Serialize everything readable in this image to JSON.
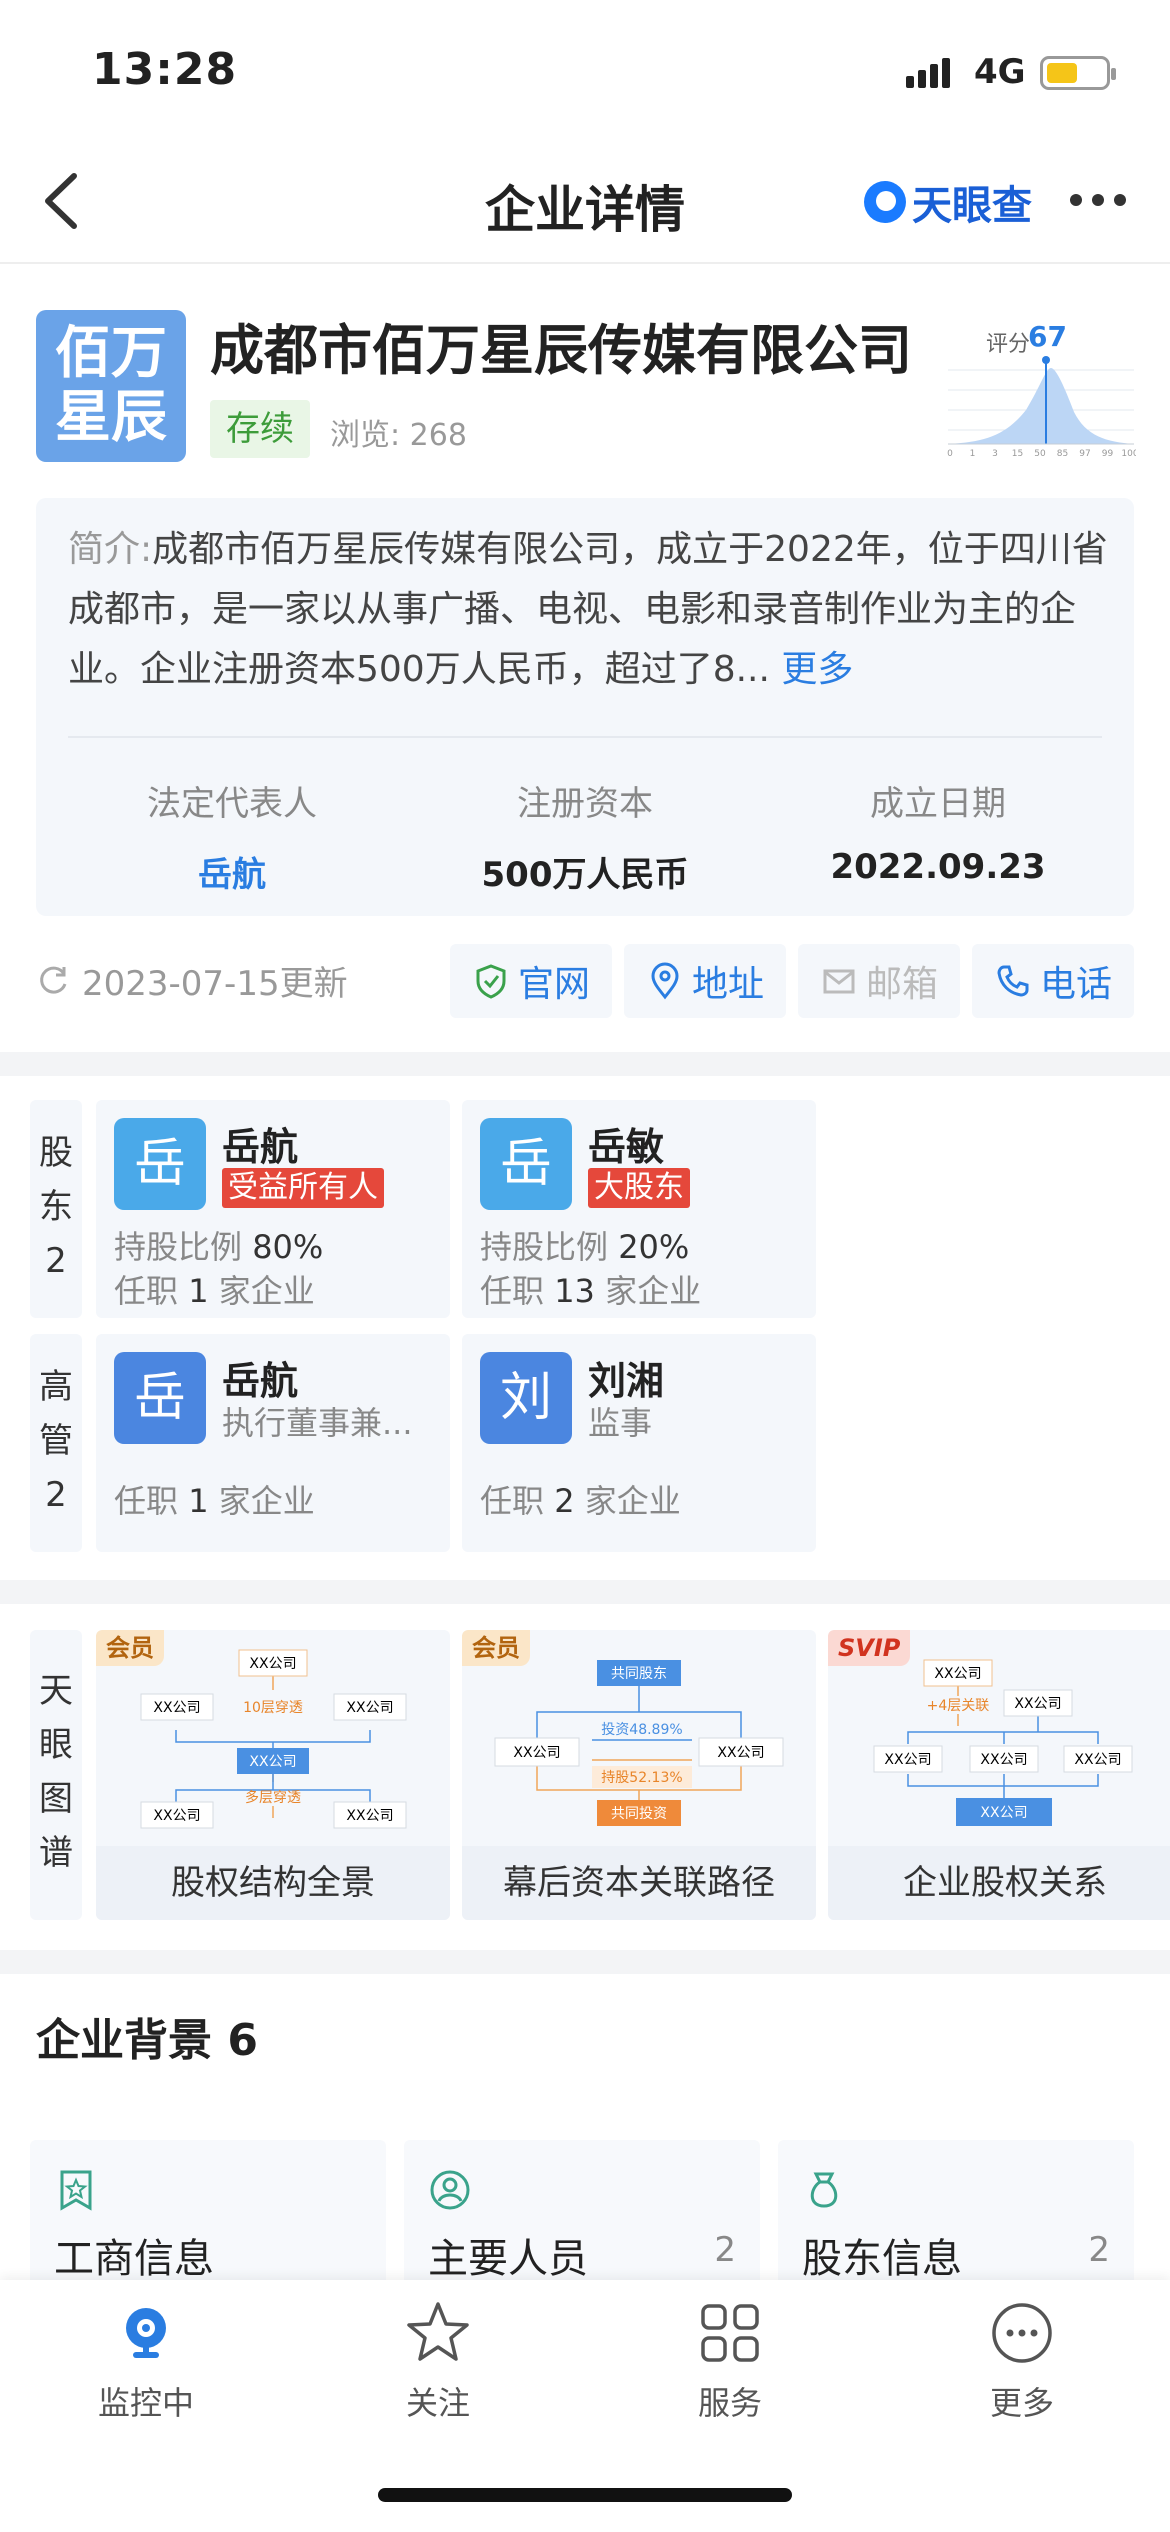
{
  "status_bar": {
    "time": "13:28",
    "network": "4G"
  },
  "nav": {
    "title": "企业详情",
    "brand": "天眼查"
  },
  "company": {
    "logo_line1": "佰万",
    "logo_line2": "星辰",
    "name": "成都市佰万星辰传媒有限公司",
    "status": "存续",
    "views": "浏览: 268",
    "score_label": "评分",
    "score": "67",
    "score_axis": [
      "0",
      "1",
      "3",
      "15",
      "50",
      "85",
      "97",
      "99",
      "100"
    ]
  },
  "intro": {
    "label": "简介:",
    "text": "成都市佰万星辰传媒有限公司，成立于2022年，位于四川省成都市，是一家以从事广播、电视、电影和录音制作业为主的企业。企业注册资本500万人民币，超过了8...",
    "more": "更多",
    "legal_rep_label": "法定代表人",
    "legal_rep": "岳航",
    "capital_label": "注册资本",
    "capital": "500万人民币",
    "founded_label": "成立日期",
    "founded": "2022.09.23"
  },
  "update": {
    "text": "2023-07-15更新"
  },
  "contacts": {
    "website": "官网",
    "address": "地址",
    "email": "邮箱",
    "phone": "电话"
  },
  "shareholders": {
    "label_chars": [
      "股",
      "东",
      "2"
    ],
    "items": [
      {
        "avatar": "岳",
        "name": "岳航",
        "tag": "受益所有人",
        "ratio_label": "持股比例",
        "ratio": "80%",
        "job_prefix": "任职",
        "job_count": "1",
        "job_suffix": "家企业"
      },
      {
        "avatar": "岳",
        "name": "岳敏",
        "tag": "大股东",
        "ratio_label": "持股比例",
        "ratio": "20%",
        "job_prefix": "任职",
        "job_count": "13",
        "job_suffix": "家企业"
      }
    ]
  },
  "executives": {
    "label_chars": [
      "高",
      "管",
      "2"
    ],
    "items": [
      {
        "avatar": "岳",
        "name": "岳航",
        "role": "执行董事兼...",
        "job_prefix": "任职",
        "job_count": "1",
        "job_suffix": "家企业"
      },
      {
        "avatar": "刘",
        "name": "刘湘",
        "role": "监事",
        "job_prefix": "任职",
        "job_count": "2",
        "job_suffix": "家企业"
      }
    ]
  },
  "graph": {
    "label_chars": [
      "天",
      "眼",
      "图",
      "谱"
    ],
    "cards": [
      {
        "badge": "会员",
        "label": "股权结构全景",
        "nodes": [
          "XX公司",
          "XX公司",
          "10层穿透",
          "XX公司",
          "XX公司",
          "XX公司",
          "多层穿透",
          "XX公司"
        ]
      },
      {
        "badge": "会员",
        "label": "幕后资本关联路径",
        "nodes": [
          "共同股东",
          "投资48.89%",
          "XX公司",
          "XX公司",
          "持股52.13%",
          "共同投资"
        ]
      },
      {
        "badge": "SVIP",
        "label": "企业股权关系",
        "nodes": [
          "XX公司",
          "+4层关联",
          "XX公司",
          "XX公司",
          "XX公司",
          "XX公司",
          "XX公司"
        ]
      }
    ]
  },
  "background": {
    "title": "企业背景 6",
    "cards": [
      {
        "name": "工商信息",
        "count": ""
      },
      {
        "name": "主要人员",
        "count": "2"
      },
      {
        "name": "股东信息",
        "count": "2"
      }
    ]
  },
  "tabbar": {
    "items": [
      "监控中",
      "关注",
      "服务",
      "更多"
    ],
    "active_color": "#2a7de1"
  },
  "colors": {
    "accent": "#2a7de1",
    "tag_red": "#e5483b",
    "status_green": "#3d9c3a"
  }
}
